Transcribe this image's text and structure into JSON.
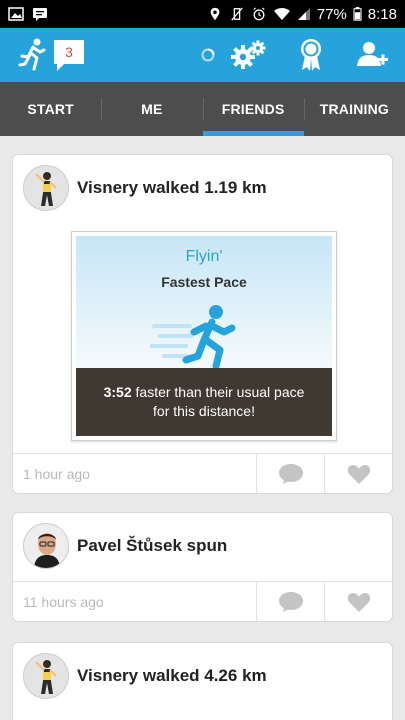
{
  "statusbar": {
    "battery": "77%",
    "time": "8:18"
  },
  "appbar": {
    "notification_count": "3"
  },
  "tabs": [
    {
      "label": "START"
    },
    {
      "label": "ME"
    },
    {
      "label": "FRIENDS"
    },
    {
      "label": "TRAINING"
    }
  ],
  "feed": {
    "items": [
      {
        "title": "Visnery walked 1.19 km",
        "achievement": {
          "title": "Flyin'",
          "subtitle": "Fastest Pace",
          "pace": "3:52",
          "line1": "faster than their usual pace",
          "line2": "for this distance!"
        },
        "time": "1 hour ago"
      },
      {
        "title": "Pavel Štůsek spun",
        "time": "11 hours ago"
      },
      {
        "title": "Visnery walked 4.26 km"
      }
    ]
  },
  "colors": {
    "accent": "#27a3dc",
    "tabbar": "#4d4d4d",
    "banner": "#3f3931"
  }
}
